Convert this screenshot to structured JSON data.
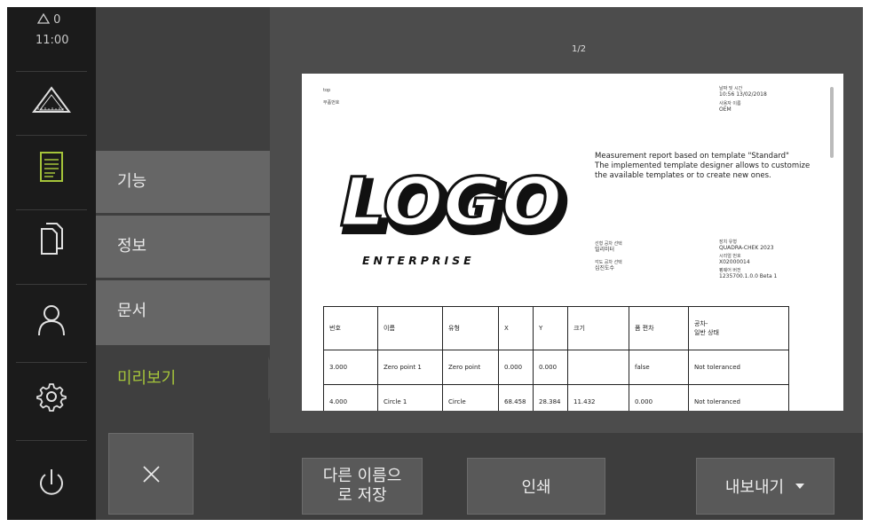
{
  "status": {
    "warning_count": "0",
    "time": "11:00"
  },
  "icons": {
    "measure": "measure-triangle-icon",
    "report": "report-document-icon",
    "files": "file-management-icon",
    "user": "user-icon",
    "settings": "gear-icon",
    "power": "power-icon",
    "close": "close-icon",
    "dropdown": "dropdown-triangle-icon"
  },
  "menu": {
    "items": [
      {
        "label": "기능"
      },
      {
        "label": "정보"
      },
      {
        "label": "문서"
      },
      {
        "label": "미리보기"
      }
    ],
    "active_color": "#a5c43a"
  },
  "preview": {
    "page_indicator": "1/2",
    "header_left": [
      "top",
      "부품번호"
    ],
    "header_right": [
      {
        "label": "날짜 및 시간",
        "value": "10:56 13/02/2018"
      },
      {
        "label": "사용자 이름",
        "value": "OEM"
      }
    ],
    "description": "Measurement report based on template \"Standard\"\nThe implemented template designer allows to customize\nthe available templates or to create new ones.",
    "logo_text": "LOGO",
    "logo_sub": "ENTERPRISE",
    "mid_left": [
      {
        "label": "선형 공차 선택",
        "value": "밀리미터"
      },
      {
        "label": "각도 공차 선택",
        "value": "십진도수"
      }
    ],
    "mid_right": [
      {
        "label": "장치 유형",
        "value": "QUADRA-CHEK 2023"
      },
      {
        "label": "시리얼 번호",
        "value": "X02000014"
      },
      {
        "label": "펌웨어 버전",
        "value": "1235700.1.0.0 Beta 1"
      }
    ],
    "table": {
      "headers": [
        "번호",
        "이름",
        "유형",
        "X",
        "Y",
        "크기",
        "폼 편차",
        "공차-\n일반 상태"
      ],
      "rows": [
        [
          "3.000",
          "Zero point 1",
          "Zero point",
          "0.000",
          "0.000",
          "",
          "false",
          "Not toleranced"
        ],
        [
          "4.000",
          "Circle 1",
          "Circle",
          "68.458",
          "28.384",
          "11.432",
          "0.000",
          "Not toleranced"
        ]
      ]
    }
  },
  "buttons": {
    "save_as": "다른 이름으\n로 저장",
    "print": "인쇄",
    "export": "내보내기"
  }
}
